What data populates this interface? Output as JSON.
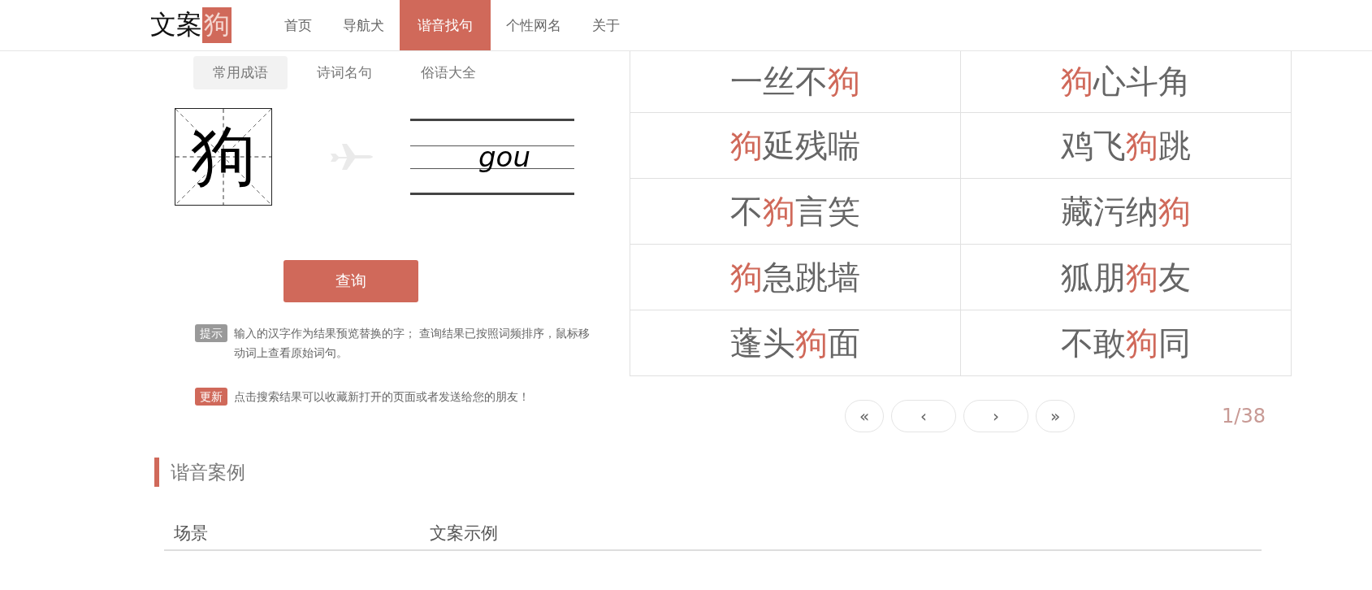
{
  "header": {
    "logo": {
      "text": "文案",
      "mark": "狗"
    },
    "nav": [
      {
        "label": "首页",
        "selected": false
      },
      {
        "label": "导航犬",
        "selected": false
      },
      {
        "label": "谐音找句",
        "selected": true
      },
      {
        "label": "个性网名",
        "selected": false
      },
      {
        "label": "关于",
        "selected": false
      }
    ]
  },
  "sub_tabs": [
    {
      "label": "常用成语",
      "selected": true
    },
    {
      "label": "诗词名句",
      "selected": false
    },
    {
      "label": "俗语大全",
      "selected": false
    }
  ],
  "input_character": "狗",
  "pinyin": "gou",
  "query_button": "查询",
  "notes": [
    {
      "badge": "提示",
      "kind": "tip",
      "text": "输入的汉字作为结果预览替换的字； 查询结果已按照词频排序，鼠标移动词上查看原始词句。"
    },
    {
      "badge": "更新",
      "kind": "update",
      "text": "点击搜索结果可以收藏新打开的页面或者发送给您的朋友！"
    }
  ],
  "results": [
    [
      {
        "text": "一丝不",
        "highlighted": false
      },
      {
        "text": "狗",
        "highlighted": true
      }
    ],
    [
      {
        "text": "狗",
        "highlighted": true
      },
      {
        "text": "心斗角",
        "highlighted": false
      }
    ],
    [
      {
        "text": "狗",
        "highlighted": true
      },
      {
        "text": "延残喘",
        "highlighted": false
      }
    ],
    [
      {
        "text": "鸡飞",
        "highlighted": false
      },
      {
        "text": "狗",
        "highlighted": true
      },
      {
        "text": "跳",
        "highlighted": false
      }
    ],
    [
      {
        "text": "不",
        "highlighted": false
      },
      {
        "text": "狗",
        "highlighted": true
      },
      {
        "text": "言笑",
        "highlighted": false
      }
    ],
    [
      {
        "text": "藏污纳",
        "highlighted": false
      },
      {
        "text": "狗",
        "highlighted": true
      }
    ],
    [
      {
        "text": "狗",
        "highlighted": true
      },
      {
        "text": "急跳墙",
        "highlighted": false
      }
    ],
    [
      {
        "text": "狐朋",
        "highlighted": false
      },
      {
        "text": "狗",
        "highlighted": true
      },
      {
        "text": "友",
        "highlighted": false
      }
    ],
    [
      {
        "text": "蓬头",
        "highlighted": false
      },
      {
        "text": "狗",
        "highlighted": true
      },
      {
        "text": "面",
        "highlighted": false
      }
    ],
    [
      {
        "text": "不敢",
        "highlighted": false
      },
      {
        "text": "狗",
        "highlighted": true
      },
      {
        "text": "同",
        "highlighted": false
      }
    ]
  ],
  "pagination": {
    "buttons": [
      {
        "label": "«",
        "kind": "first"
      },
      {
        "label": "‹",
        "kind": "prev"
      },
      {
        "label": "›",
        "kind": "next"
      },
      {
        "label": "»",
        "kind": "last"
      }
    ],
    "page": "1/38"
  },
  "section": {
    "title": "谐音案例",
    "columns": [
      "场景",
      "文案示例"
    ]
  }
}
